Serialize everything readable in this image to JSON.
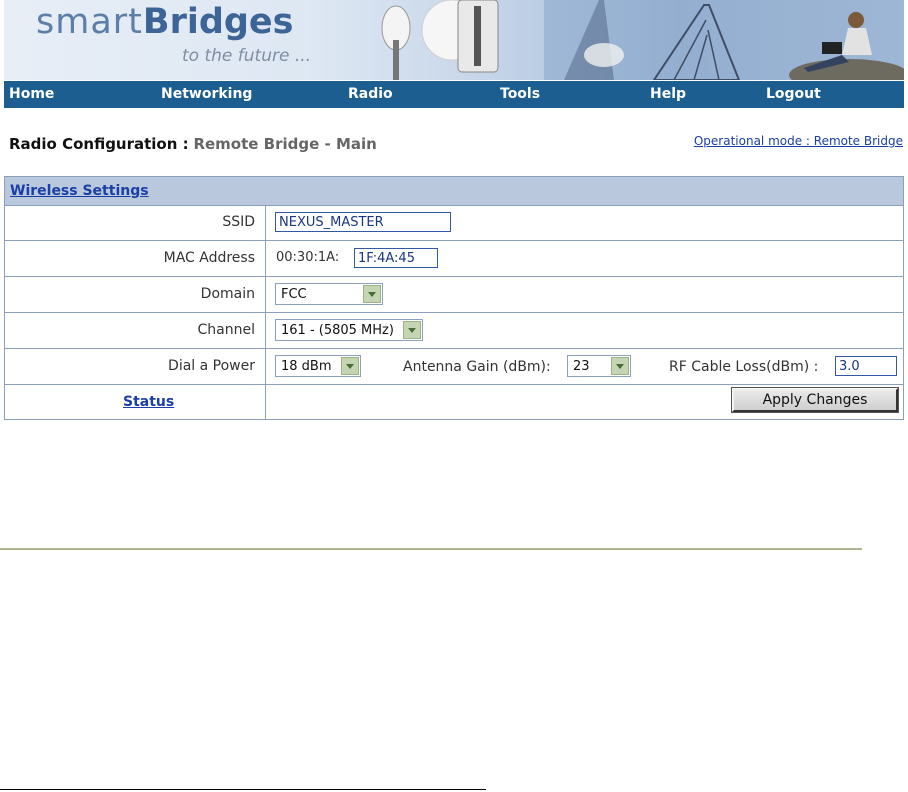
{
  "banner": {
    "logo_part1": "smart",
    "logo_part2": "Bridges",
    "tagline": "to the future ..."
  },
  "nav": {
    "items": [
      {
        "label": "Home"
      },
      {
        "label": "Networking"
      },
      {
        "label": "Radio"
      },
      {
        "label": "Tools"
      },
      {
        "label": "Help"
      },
      {
        "label": "Logout"
      }
    ]
  },
  "header": {
    "title_bold": "Radio Configuration :",
    "title_rest": "Remote Bridge - Main",
    "operational_mode": "Operational mode : Remote Bridge"
  },
  "wireless": {
    "section_title": "Wireless Settings",
    "ssid": {
      "label": "SSID",
      "value": "NEXUS_MASTER"
    },
    "mac": {
      "label": "MAC Address",
      "prefix": "00:30:1A:",
      "value": "1F:4A:45"
    },
    "domain": {
      "label": "Domain",
      "value": "FCC"
    },
    "channel": {
      "label": "Channel",
      "value": "161 - (5805 MHz)"
    },
    "power": {
      "label": "Dial a Power",
      "value": "18 dBm",
      "antenna_label": "Antenna Gain (dBm):",
      "antenna_value": "23",
      "cable_label": "RF Cable Loss(dBm) :",
      "cable_value": "3.0"
    },
    "status_link": "Status",
    "apply_button": "Apply Changes"
  },
  "colors": {
    "nav_bg": "#1c5e8f",
    "header_bg": "#b9c8dc",
    "link": "#1a3fa6"
  }
}
